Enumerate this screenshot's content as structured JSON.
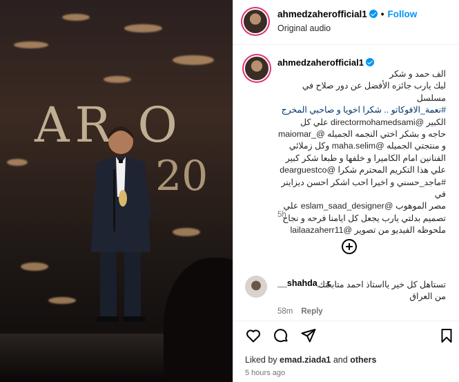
{
  "post": {
    "username": "ahmedzaherofficial1",
    "follow_label": "Follow",
    "audio_label": "Original audio",
    "caption_lines": [
      "الف حمد و شكر",
      "ليك يارب جائزه الأفضل عن دور صلاح في مسلسل",
      "#نعمة_الافوكاتو .. شكرا اخويا و صاحبي المخرج",
      "الكبير @directormohamedsami علي كل",
      "حاجه و بشكر اختي النجمه الجميله @_maiomar",
      "و منتجتي الجميله @maha.selim وكل زملائي",
      "الفنانين امام الكاميرا و خلفها و طبعا شكر كبير",
      "علي هذا التكريم المحترم شكرا @dearguestco",
      "#ماجد_حسني و اخيرا احب اشكر احسن ديزاينر في",
      "مصر الموهوب @eslam_saad_designer علي",
      "تصميم بدلتي يارب يجعل كل ايامنا فرحه و نجاح",
      "ملحوظه الفيديو من تصوير @lailaazaherr11"
    ],
    "caption_time": "5h"
  },
  "comment": {
    "username": "__shahda__r",
    "text_line1": "تستاهل كل خير يااستاذ احمد متابعتك",
    "text_line2": "من العراق",
    "time": "58m",
    "reply_label": "Reply"
  },
  "footer": {
    "liked_prefix": "Liked by ",
    "liked_user": "emad.ziada1",
    "liked_and": " and ",
    "liked_others": "others",
    "posted_ago": "5 hours ago"
  },
  "icons": {
    "heart": "heart-icon",
    "comment": "comment-icon",
    "share": "share-icon",
    "save": "bookmark-icon",
    "add": "add-circle-icon"
  },
  "colors": {
    "link": "#00376b",
    "follow": "#0095f6",
    "muted": "#737373",
    "story_ring": "#e1306c"
  }
}
